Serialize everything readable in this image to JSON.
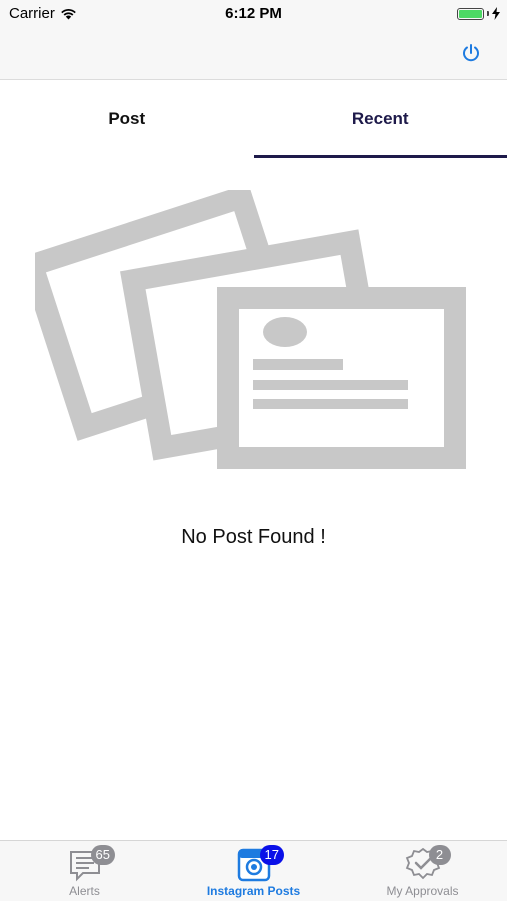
{
  "status_bar": {
    "carrier": "Carrier",
    "time": "6:12 PM"
  },
  "nav": {
    "power_icon": "power-icon"
  },
  "tabs": [
    {
      "label": "Post",
      "active": false
    },
    {
      "label": "Recent",
      "active": true
    }
  ],
  "empty_state": {
    "message": "No Post Found !"
  },
  "tabbar": [
    {
      "label": "Alerts",
      "badge": "65",
      "icon": "alerts-icon",
      "badge_color": "#8e8e93"
    },
    {
      "label": "Instagram Posts",
      "badge": "17",
      "icon": "instagram-icon",
      "badge_color": "#0a10e8",
      "active": true
    },
    {
      "label": "My Approvals",
      "badge": "2",
      "icon": "approvals-icon",
      "badge_color": "#8e8e93"
    }
  ],
  "colors": {
    "accent": "#1e7be0",
    "tab_indicator": "#1e1a4a",
    "placeholder_gray": "#c8c8c8"
  }
}
